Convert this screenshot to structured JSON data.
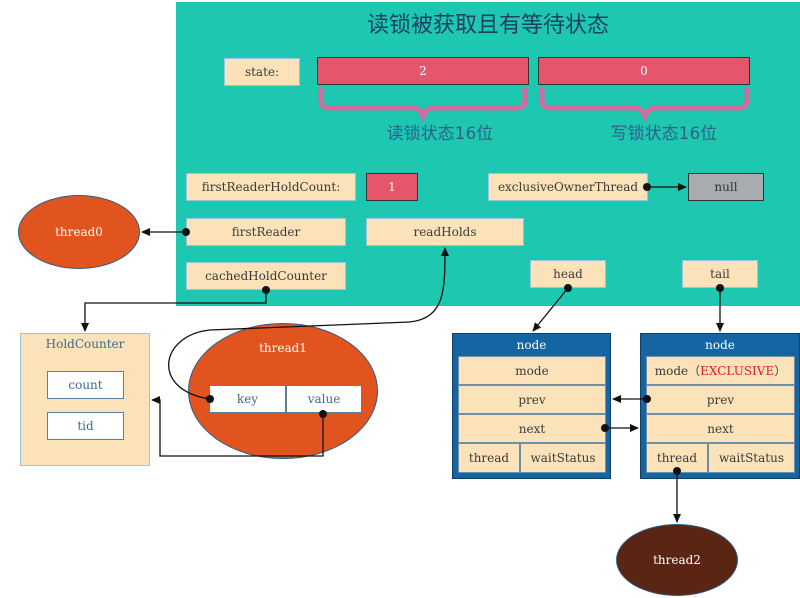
{
  "title": "读锁被获取且有等待状态",
  "state": {
    "label": "state:",
    "read_value": "2",
    "write_value": "0",
    "read_brace_label": "读锁状态16位",
    "write_brace_label": "写锁状态16位"
  },
  "fields": {
    "first_reader_hold_count_label": "firstReaderHoldCount:",
    "first_reader_hold_count_value": "1",
    "exclusive_owner_thread_label": "exclusiveOwnerThread",
    "exclusive_owner_thread_value": "null",
    "first_reader_label": "firstReader",
    "read_holds_label": "readHolds",
    "cached_hold_counter_label": "cachedHoldCounter",
    "head_label": "head",
    "tail_label": "tail"
  },
  "threads": {
    "thread0": "thread0",
    "thread1": "thread1",
    "thread2": "thread2"
  },
  "hold_counter": {
    "title": "HoldCounter",
    "count": "count",
    "tid": "tid"
  },
  "entry": {
    "key": "key",
    "value": "value"
  },
  "head_node": {
    "title": "node",
    "mode": "mode",
    "prev": "prev",
    "next": "next",
    "thread": "thread",
    "wait_status": "waitStatus"
  },
  "tail_node": {
    "title": "node",
    "mode_prefix": "mode（",
    "mode_value": "EXCLUSIVE",
    "mode_suffix": "）",
    "prev": "prev",
    "next": "next",
    "thread": "thread",
    "wait_status": "waitStatus"
  },
  "colors": {
    "panel": "#1ec8b0",
    "peach": "#fce2b9",
    "red": "#e5556b",
    "orange": "#e2541f",
    "dark_brown": "#5a2512",
    "node_blue": "#1665a3",
    "brace": "#d36ba1",
    "gray": "#a9acae"
  }
}
